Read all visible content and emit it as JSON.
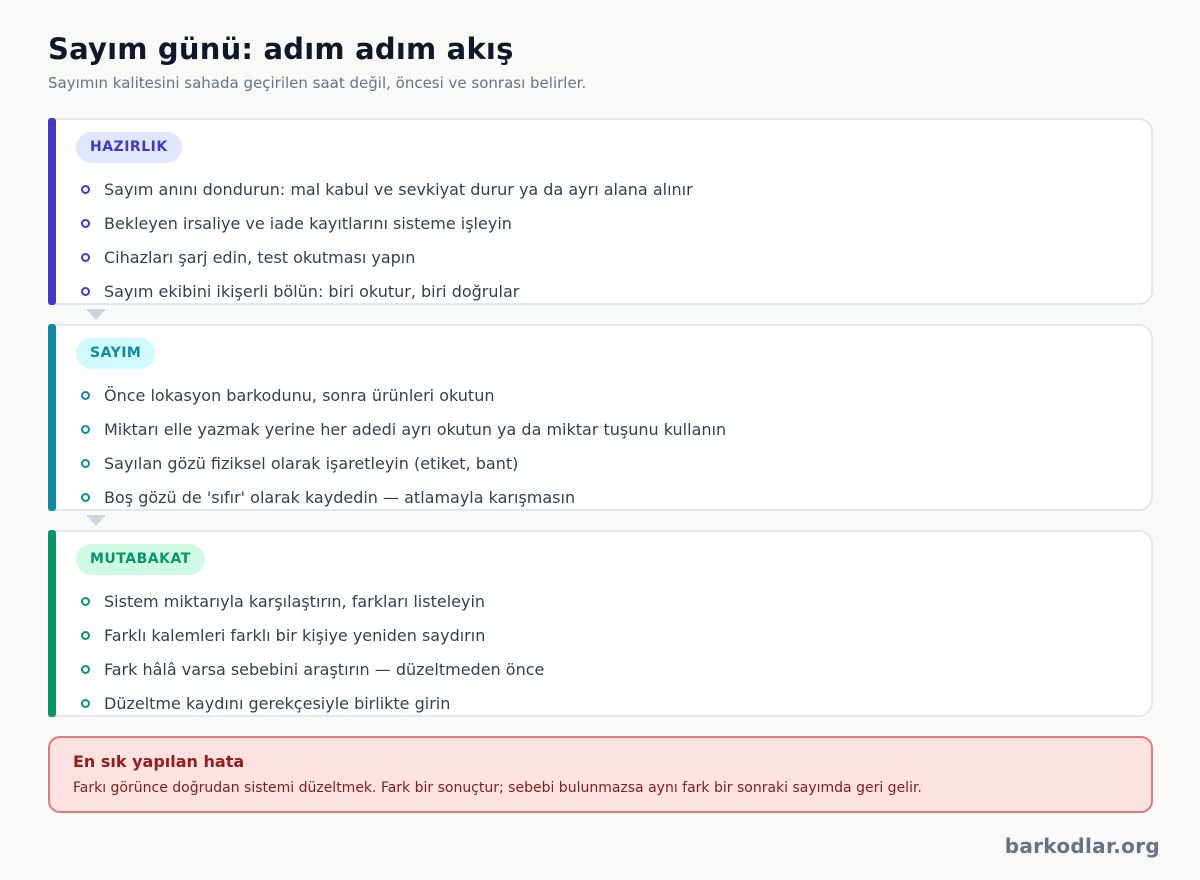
{
  "title": "Sayım günü: adım adım akış",
  "subtitle": "Sayımın kalitesini sahada geçirilen saat değil, öncesi ve sonrası belirler.",
  "stages": [
    {
      "label": "HAZIRLIK",
      "color": "#4338ca",
      "badge_bg": "#e0e7ff",
      "items": [
        "Sayım anını dondurun: mal kabul ve sevkiyat durur ya da ayrı alana alınır",
        "Bekleyen irsaliye ve iade kayıtlarını sisteme işleyin",
        "Cihazları şarj edin, test okutması yapın",
        "Sayım ekibini ikişerli bölün: biri okutur, biri doğrular"
      ]
    },
    {
      "label": "SAYIM",
      "color": "#0e8aa5",
      "badge_bg": "#cffafe",
      "items": [
        "Önce lokasyon barkodunu, sonra ürünleri okutun",
        "Miktarı elle yazmak yerine her adedi ayrı okutun ya da miktar tuşunu kullanın",
        "Sayılan gözü fiziksel olarak işaretleyin (etiket, bant)",
        "Boş gözü de 'sıfır' olarak kaydedin — atlamayla karışmasın"
      ]
    },
    {
      "label": "MUTABAKAT",
      "color": "#059669",
      "badge_bg": "#d1fae5",
      "items": [
        "Sistem miktarıyla karşılaştırın, farkları listeleyin",
        "Farklı kalemleri farklı bir kişiye yeniden saydırın",
        "Fark hâlâ varsa sebebini araştırın — düzeltmeden önce",
        "Düzeltme kaydını gerekçesiyle birlikte girin"
      ]
    }
  ],
  "warning": {
    "title": "En sık yapılan hata",
    "text": "Farkı görünce doğrudan sistemi düzeltmek. Fark bir sonuçtur; sebebi bulunmazsa aynı fark bir sonraki sayımda geri gelir."
  },
  "brand": "barkodlar.org"
}
